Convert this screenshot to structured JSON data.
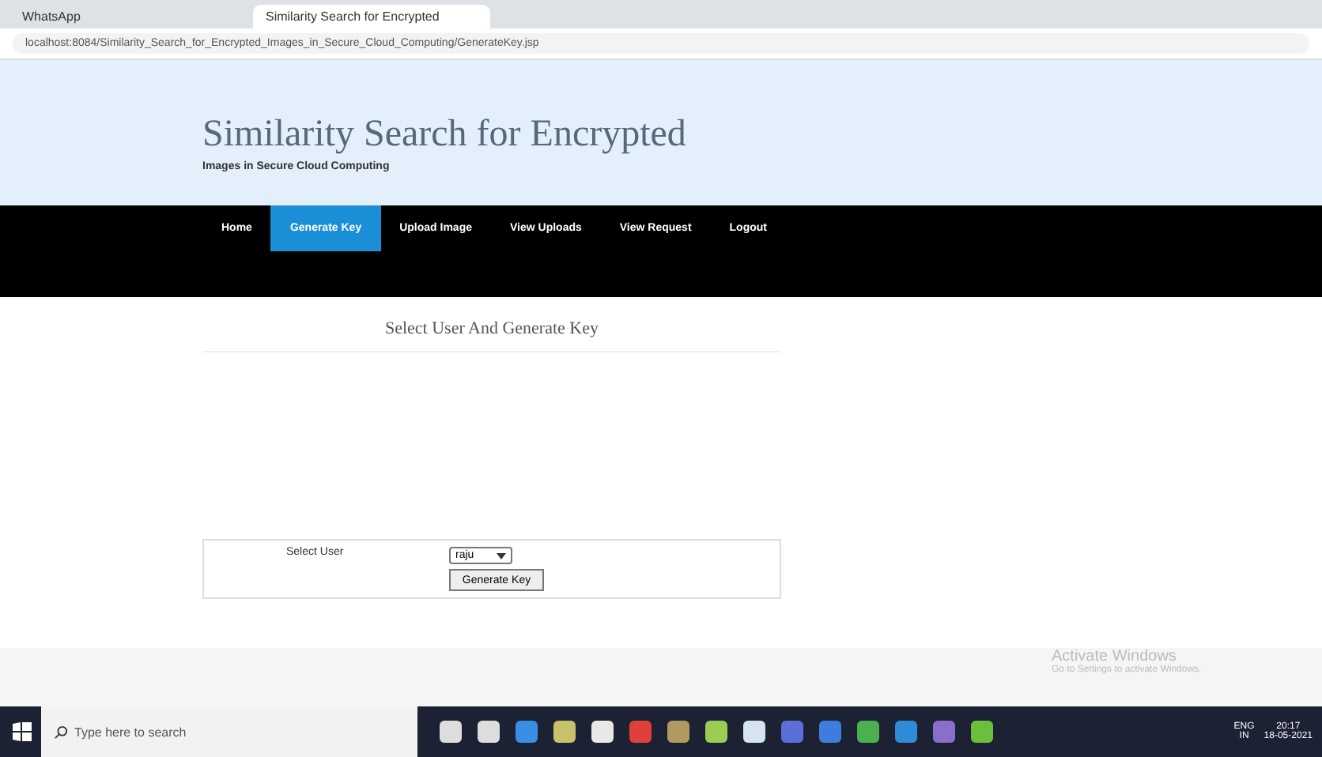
{
  "browser": {
    "tabs": [
      {
        "title": "WhatsApp",
        "selected": false
      },
      {
        "title": "Similarity Search for Encrypted",
        "selected": true
      }
    ],
    "url": "localhost:8084/Similarity_Search_for_Encrypted_Images_in_Secure_Cloud_Computing/GenerateKey.jsp"
  },
  "header": {
    "title": "Similarity Search for Encrypted",
    "subtitle": "Images in Secure Cloud Computing"
  },
  "nav": [
    {
      "label": "Home",
      "selected": false
    },
    {
      "label": "Generate Key",
      "selected": true
    },
    {
      "label": "Upload Image",
      "selected": false
    },
    {
      "label": "View Uploads",
      "selected": false
    },
    {
      "label": "View Request",
      "selected": false
    },
    {
      "label": "Logout",
      "selected": false
    }
  ],
  "section_title": "Select User And Generate Key",
  "form": {
    "label": "Select User",
    "user": "raju",
    "button": "Generate Key"
  },
  "watermark": {
    "title": "Activate Windows",
    "subtitle": "Go to Settings to activate Windows."
  },
  "taskbar": {
    "search_placeholder": "Type here to search",
    "lang": "ENG",
    "region": "IN",
    "time": "20:17",
    "date": "18-05-2021"
  }
}
